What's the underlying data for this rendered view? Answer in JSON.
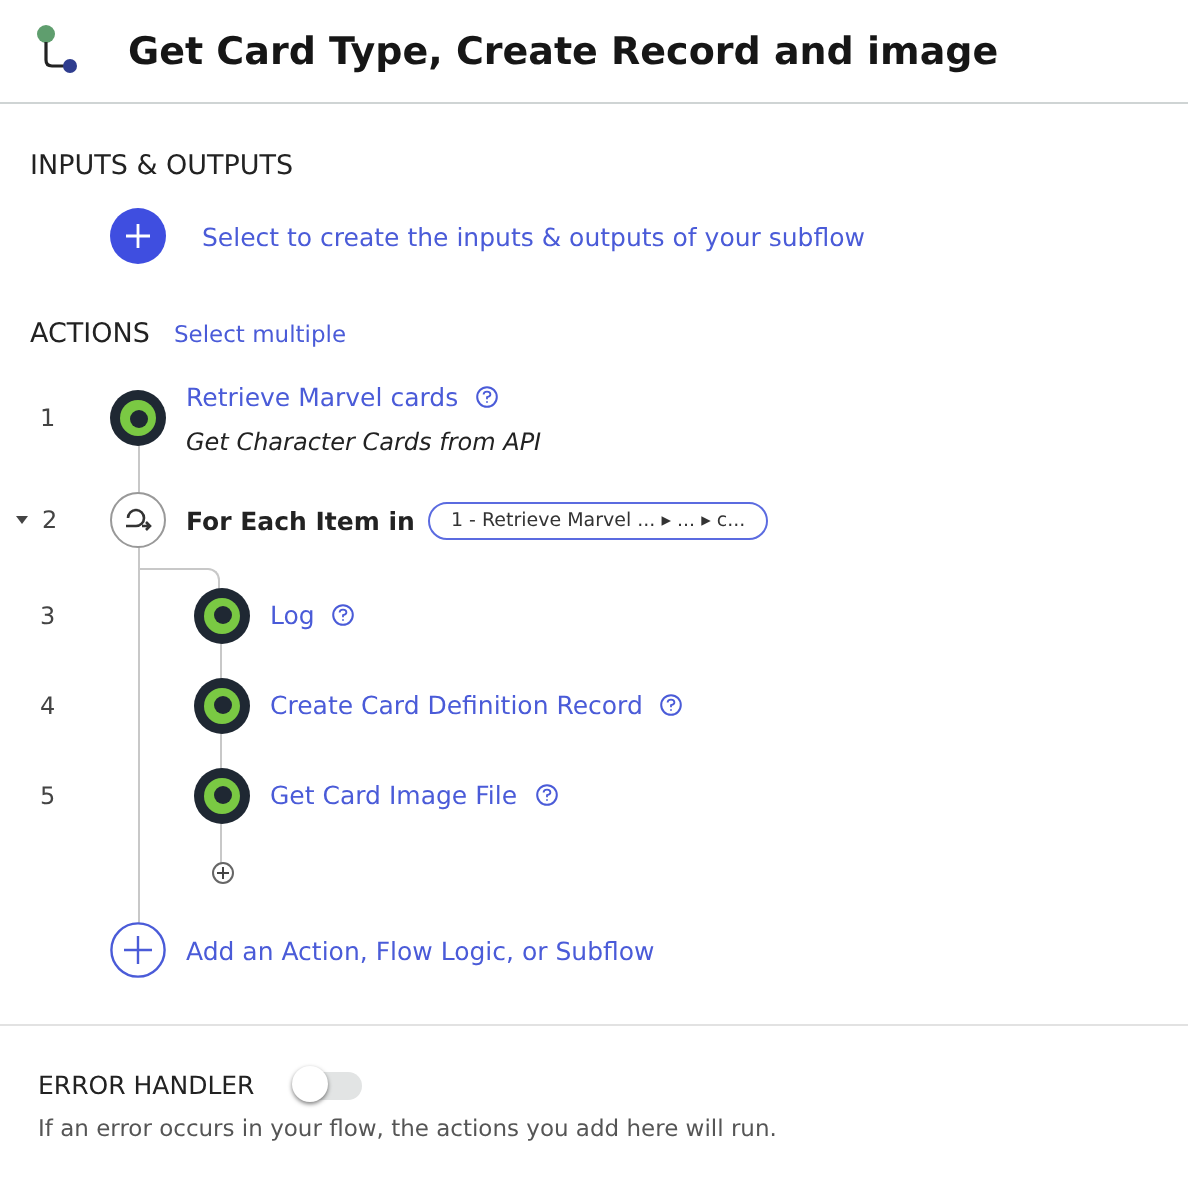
{
  "header": {
    "title": "Get Card Type, Create Record and image"
  },
  "inputs_outputs": {
    "heading": "INPUTS & OUTPUTS",
    "link": "Select to create the inputs & outputs of your subflow"
  },
  "actions": {
    "heading": "ACTIONS",
    "select_link": "Select multiple",
    "steps": [
      {
        "kind": "action",
        "number": "1",
        "title": "Retrieve Marvel cards",
        "description": "Get Character Cards from API"
      },
      {
        "kind": "loop",
        "number": "2",
        "expanded": true,
        "label": "For Each Item in",
        "pill": "1 - Retrieve Marvel ... ▸ ... ▸ c...",
        "children": [
          {
            "kind": "action",
            "number": "3",
            "title": "Log"
          },
          {
            "kind": "action",
            "number": "4",
            "title": "Create Card Definition Record"
          },
          {
            "kind": "action",
            "number": "5",
            "title": "Get Card Image File"
          }
        ]
      }
    ],
    "add_link": "Add an Action, Flow Logic, or Subflow"
  },
  "error_handler": {
    "heading": "ERROR HANDLER",
    "on": false,
    "description": "If an error occurs in your flow, the actions you add here will run."
  }
}
